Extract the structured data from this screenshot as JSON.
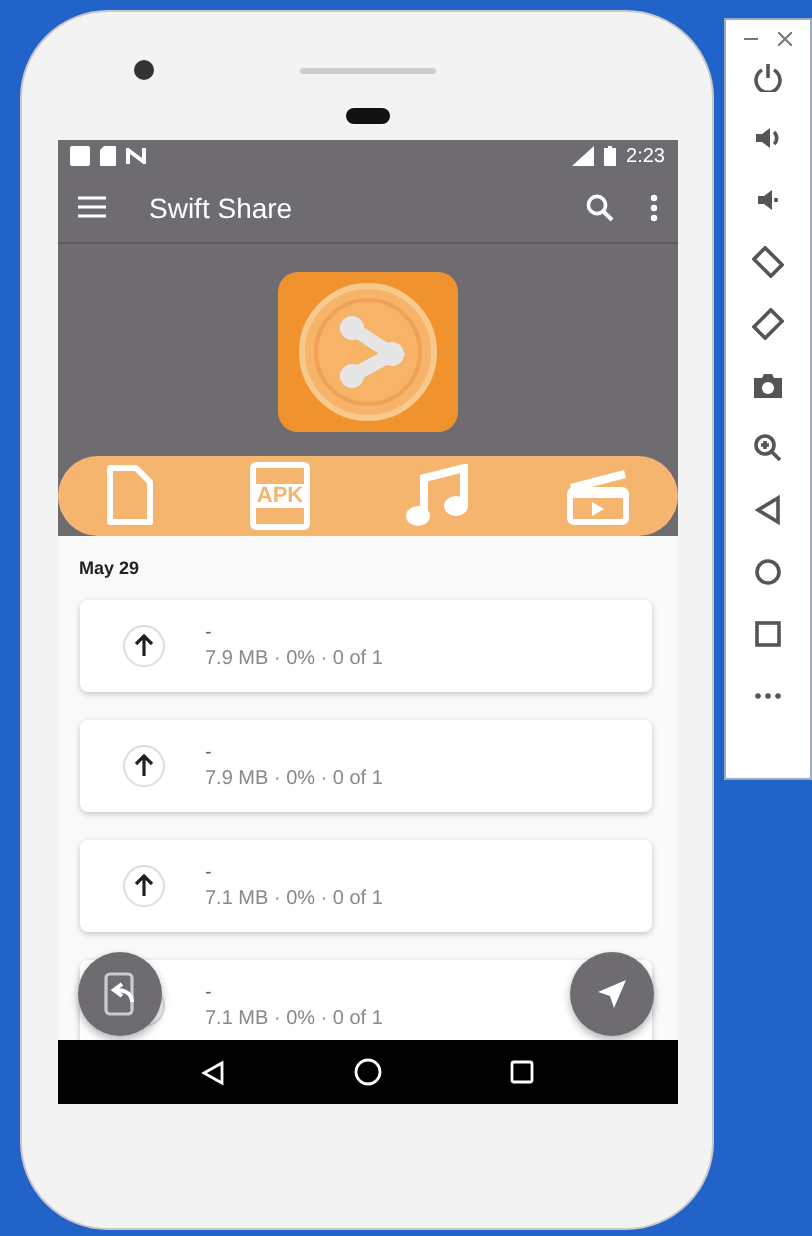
{
  "status_bar": {
    "time": "2:23"
  },
  "app_bar": {
    "title": "Swift Share"
  },
  "categories": [
    {
      "kind": "file"
    },
    {
      "kind": "apk",
      "label": "APK"
    },
    {
      "kind": "music"
    },
    {
      "kind": "video"
    }
  ],
  "section": {
    "date": "May 29"
  },
  "transfers": [
    {
      "title": "-",
      "details": "7.9 MB · 0% · 0 of 1"
    },
    {
      "title": "-",
      "details": "7.9 MB · 0% · 0 of 1"
    },
    {
      "title": "-",
      "details": "7.1 MB · 0% · 0 of 1"
    },
    {
      "title": "-",
      "details": "7.1 MB · 0% · 0 of 1"
    }
  ]
}
